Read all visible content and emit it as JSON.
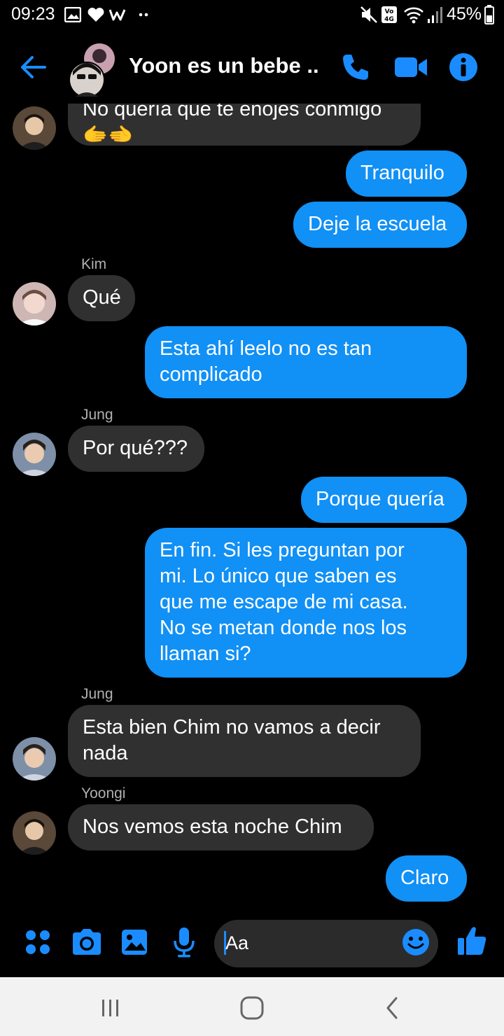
{
  "status_bar": {
    "time": "09:23",
    "battery": "45%",
    "icons": [
      "gallery-icon",
      "heart-icon",
      "w-app-icon",
      "more-dots-icon",
      "mute-icon",
      "volte-4g-icon",
      "wifi-icon",
      "signal-icon",
      "battery-icon"
    ]
  },
  "header": {
    "title": "Yoon es un bebe ...",
    "accent_color": "#1a8cff"
  },
  "messages": {
    "m0": {
      "text": "No quería que te enojes conmigo\n🫱🫲",
      "partial": true
    },
    "m1": {
      "text": "Tranquilo"
    },
    "m2": {
      "text": "Deje la escuela"
    },
    "m3": {
      "sender": "Kim",
      "text": "Qué"
    },
    "m4": {
      "text": "Esta ahí leelo no es tan\ncomplicado"
    },
    "m5": {
      "sender": "Jung",
      "text": "Por qué???"
    },
    "m6": {
      "text": "Porque quería"
    },
    "m7": {
      "text": "En fin. Si les preguntan por\nmi. Lo único que saben es\nque me escape de mi casa.\nNo se metan donde nos los\nllaman si?"
    },
    "m8": {
      "sender": "Jung",
      "text": "Esta bien Chim no vamos a decir\nnada"
    },
    "m9": {
      "sender": "Yoongi",
      "text": "Nos vemos esta noche Chim"
    },
    "m10": {
      "text": "Claro"
    }
  },
  "composer": {
    "placeholder": "Aa",
    "buttons": [
      "apps-icon",
      "camera-icon",
      "image-icon",
      "microphone-icon",
      "emoji-icon",
      "thumbs-up-icon"
    ]
  },
  "colors": {
    "outgoing_bubble": "#1190f5",
    "incoming_bubble": "#303030",
    "background": "#000000",
    "nav_bar": "#f2f2f2"
  }
}
